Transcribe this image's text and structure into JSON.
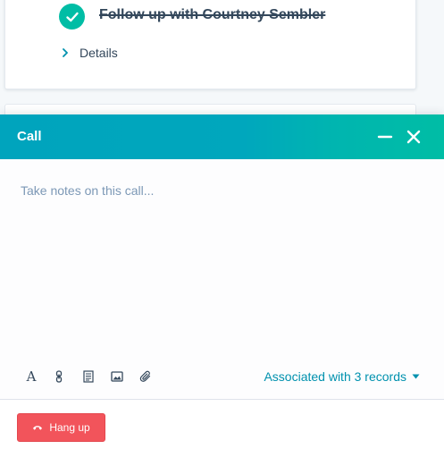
{
  "task": {
    "title": "Follow up with Courtney Sembler",
    "completed": true,
    "details_label": "Details"
  },
  "call_panel": {
    "title": "Call",
    "notes_placeholder": "Take notes on this call...",
    "associated_label": "Associated with 3 records",
    "hangup_label": "Hang up"
  },
  "icons": {
    "check": "check-icon",
    "chevron_right": "chevron-right-icon",
    "minimize": "minimize-icon",
    "close": "close-icon",
    "text_format": "text-format-icon",
    "link": "link-icon",
    "document": "document-icon",
    "image": "image-icon",
    "attachment": "paperclip-icon",
    "caret_down": "caret-down-icon",
    "phone_hangup": "phone-hangup-icon"
  },
  "colors": {
    "header_teal": "#00a4bd",
    "check_green": "#00bda5",
    "link_blue": "#0091ae",
    "hangup_red": "#f2545b",
    "text_dark": "#33475b",
    "placeholder": "#7c98b6"
  }
}
